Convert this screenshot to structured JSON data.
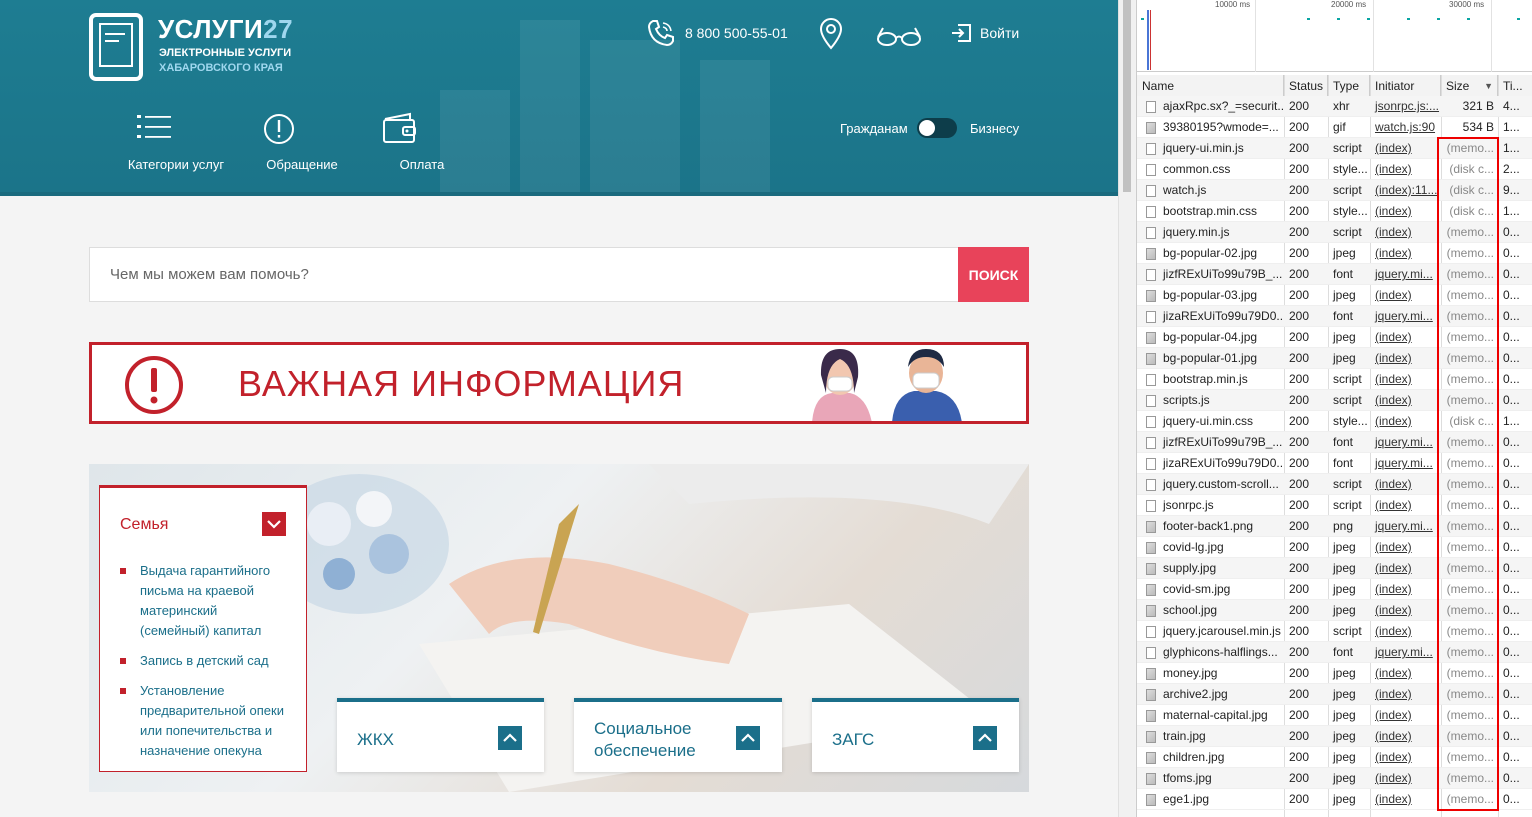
{
  "header": {
    "logo_title": "УСЛУГИ",
    "logo_num": "27",
    "logo_sub1": "ЭЛЕКТРОННЫЕ УСЛУГИ",
    "logo_sub2": "ХАБАРОВСКОГО КРАЯ",
    "phone": "8 800 500-55-01",
    "login": "Войти",
    "nav": [
      {
        "label": "Категории услуг",
        "icon": "list-icon"
      },
      {
        "label": "Обращение",
        "icon": "exclamation-circle-icon"
      },
      {
        "label": "Оплата",
        "icon": "wallet-icon"
      }
    ],
    "toggle_left": "Гражданам",
    "toggle_right": "Бизнесу"
  },
  "search": {
    "placeholder": "Чем мы можем вам помочь?",
    "button": "ПОИСК"
  },
  "important": {
    "text": "ВАЖНАЯ  ИНФОРМАЦИЯ"
  },
  "family": {
    "title": "Семья",
    "items": [
      "Выдача гарантийного письма на краевой материнский (семейный) капитал",
      "Запись в детский сад",
      "Установление предварительной опеки или попечительства и назначение опекуна"
    ]
  },
  "categories": [
    {
      "label": "ЖКХ"
    },
    {
      "label": "Социальное обеспечение"
    },
    {
      "label": "ЗАГС"
    }
  ],
  "devtools": {
    "overview_ticks": [
      "10000 ms",
      "20000 ms",
      "30000 ms"
    ],
    "columns": [
      "Name",
      "Status",
      "Type",
      "Initiator",
      "Size",
      "Ti..."
    ],
    "rows": [
      {
        "name": "ajaxRpc.sx?_=securit...",
        "status": "200",
        "type": "xhr",
        "initiator": "jsonrpc.js:...",
        "size": "321 B",
        "time": "4..."
      },
      {
        "name": "39380195?wmode=...",
        "status": "200",
        "type": "gif",
        "initiator": "watch.js:90",
        "size": "534 B",
        "time": "1..."
      },
      {
        "name": "jquery-ui.min.js",
        "status": "200",
        "type": "script",
        "initiator": "(index)",
        "size": "(memo...",
        "time": "1..."
      },
      {
        "name": "common.css",
        "status": "200",
        "type": "style...",
        "initiator": "(index)",
        "size": "(disk c...",
        "time": "2..."
      },
      {
        "name": "watch.js",
        "status": "200",
        "type": "script",
        "initiator": "(index):11...",
        "size": "(disk c...",
        "time": "9..."
      },
      {
        "name": "bootstrap.min.css",
        "status": "200",
        "type": "style...",
        "initiator": "(index)",
        "size": "(disk c...",
        "time": "1..."
      },
      {
        "name": "jquery.min.js",
        "status": "200",
        "type": "script",
        "initiator": "(index)",
        "size": "(memo...",
        "time": "0..."
      },
      {
        "name": "bg-popular-02.jpg",
        "status": "200",
        "type": "jpeg",
        "initiator": "(index)",
        "size": "(memo...",
        "time": "0..."
      },
      {
        "name": "jizfRExUiTo99u79B_...",
        "status": "200",
        "type": "font",
        "initiator": "jquery.mi...",
        "size": "(memo...",
        "time": "0..."
      },
      {
        "name": "bg-popular-03.jpg",
        "status": "200",
        "type": "jpeg",
        "initiator": "(index)",
        "size": "(memo...",
        "time": "0..."
      },
      {
        "name": "jizaRExUiTo99u79D0...",
        "status": "200",
        "type": "font",
        "initiator": "jquery.mi...",
        "size": "(memo...",
        "time": "0..."
      },
      {
        "name": "bg-popular-04.jpg",
        "status": "200",
        "type": "jpeg",
        "initiator": "(index)",
        "size": "(memo...",
        "time": "0..."
      },
      {
        "name": "bg-popular-01.jpg",
        "status": "200",
        "type": "jpeg",
        "initiator": "(index)",
        "size": "(memo...",
        "time": "0..."
      },
      {
        "name": "bootstrap.min.js",
        "status": "200",
        "type": "script",
        "initiator": "(index)",
        "size": "(memo...",
        "time": "0..."
      },
      {
        "name": "scripts.js",
        "status": "200",
        "type": "script",
        "initiator": "(index)",
        "size": "(memo...",
        "time": "0..."
      },
      {
        "name": "jquery-ui.min.css",
        "status": "200",
        "type": "style...",
        "initiator": "(index)",
        "size": "(disk c...",
        "time": "1..."
      },
      {
        "name": "jizfRExUiTo99u79B_...",
        "status": "200",
        "type": "font",
        "initiator": "jquery.mi...",
        "size": "(memo...",
        "time": "0..."
      },
      {
        "name": "jizaRExUiTo99u79D0...",
        "status": "200",
        "type": "font",
        "initiator": "jquery.mi...",
        "size": "(memo...",
        "time": "0..."
      },
      {
        "name": "jquery.custom-scroll...",
        "status": "200",
        "type": "script",
        "initiator": "(index)",
        "size": "(memo...",
        "time": "0..."
      },
      {
        "name": "jsonrpc.js",
        "status": "200",
        "type": "script",
        "initiator": "(index)",
        "size": "(memo...",
        "time": "0..."
      },
      {
        "name": "footer-back1.png",
        "status": "200",
        "type": "png",
        "initiator": "jquery.mi...",
        "size": "(memo...",
        "time": "0..."
      },
      {
        "name": "covid-lg.jpg",
        "status": "200",
        "type": "jpeg",
        "initiator": "(index)",
        "size": "(memo...",
        "time": "0..."
      },
      {
        "name": "supply.jpg",
        "status": "200",
        "type": "jpeg",
        "initiator": "(index)",
        "size": "(memo...",
        "time": "0..."
      },
      {
        "name": "covid-sm.jpg",
        "status": "200",
        "type": "jpeg",
        "initiator": "(index)",
        "size": "(memo...",
        "time": "0..."
      },
      {
        "name": "school.jpg",
        "status": "200",
        "type": "jpeg",
        "initiator": "(index)",
        "size": "(memo...",
        "time": "0..."
      },
      {
        "name": "jquery.jcarousel.min.js",
        "status": "200",
        "type": "script",
        "initiator": "(index)",
        "size": "(memo...",
        "time": "0..."
      },
      {
        "name": "glyphicons-halflings...",
        "status": "200",
        "type": "font",
        "initiator": "jquery.mi...",
        "size": "(memo...",
        "time": "0..."
      },
      {
        "name": "money.jpg",
        "status": "200",
        "type": "jpeg",
        "initiator": "(index)",
        "size": "(memo...",
        "time": "0..."
      },
      {
        "name": "archive2.jpg",
        "status": "200",
        "type": "jpeg",
        "initiator": "(index)",
        "size": "(memo...",
        "time": "0..."
      },
      {
        "name": "maternal-capital.jpg",
        "status": "200",
        "type": "jpeg",
        "initiator": "(index)",
        "size": "(memo...",
        "time": "0..."
      },
      {
        "name": "train.jpg",
        "status": "200",
        "type": "jpeg",
        "initiator": "(index)",
        "size": "(memo...",
        "time": "0..."
      },
      {
        "name": "children.jpg",
        "status": "200",
        "type": "jpeg",
        "initiator": "(index)",
        "size": "(memo...",
        "time": "0..."
      },
      {
        "name": "tfoms.jpg",
        "status": "200",
        "type": "jpeg",
        "initiator": "(index)",
        "size": "(memo...",
        "time": "0..."
      },
      {
        "name": "ege1.jpg",
        "status": "200",
        "type": "jpeg",
        "initiator": "(index)",
        "size": "(memo...",
        "time": "0..."
      }
    ]
  },
  "colors": {
    "header_bg": "#1e7d92",
    "accent_red": "#c2212b",
    "search_btn": "#e8435a",
    "link_blue": "#1b6f8a",
    "highlight_box": "#e00000"
  }
}
